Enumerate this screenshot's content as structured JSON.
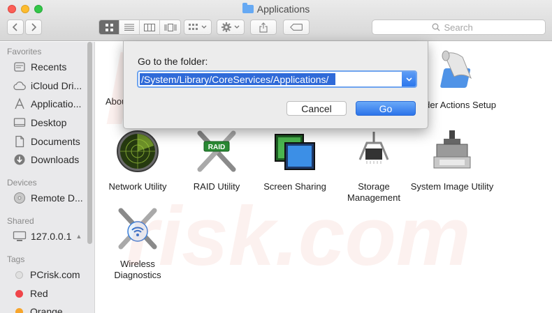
{
  "window": {
    "title": "Applications"
  },
  "toolbar": {
    "back_icon": "chevron-left-icon",
    "forward_icon": "chevron-right-icon",
    "view_modes": [
      "icon-view",
      "list-view",
      "column-view",
      "cover-flow-view"
    ],
    "search_placeholder": "Search"
  },
  "sidebar": {
    "sections": [
      {
        "title": "Favorites",
        "items": [
          {
            "label": "Recents",
            "icon": "clock-icon"
          },
          {
            "label": "iCloud Dri...",
            "icon": "cloud-icon"
          },
          {
            "label": "Applicatio...",
            "icon": "applications-icon"
          },
          {
            "label": "Desktop",
            "icon": "desktop-icon"
          },
          {
            "label": "Documents",
            "icon": "document-icon"
          },
          {
            "label": "Downloads",
            "icon": "download-icon"
          }
        ]
      },
      {
        "title": "Devices",
        "items": [
          {
            "label": "Remote D...",
            "icon": "disc-icon"
          }
        ]
      },
      {
        "title": "Shared",
        "items": [
          {
            "label": "127.0.0.1",
            "icon": "monitor-icon"
          }
        ]
      },
      {
        "title": "Tags",
        "items": [
          {
            "label": "PCrisk.com",
            "color": "#e0e0e0"
          },
          {
            "label": "Red",
            "color": "#f0454a"
          },
          {
            "label": "Orange",
            "color": "#f7a52c"
          }
        ]
      }
    ]
  },
  "apps": {
    "about": "Abou",
    "folder_actions": "older Actions Setup",
    "network_utility": "Network Utility",
    "raid_utility": "RAID Utility",
    "raid_badge": "RAID",
    "screen_sharing": "Screen Sharing",
    "storage_management": "Storage Management",
    "system_image_utility": "System Image Utility",
    "wireless_diagnostics": "Wireless Diagnostics"
  },
  "dialog": {
    "prompt": "Go to the folder:",
    "path_value": "/System/Library/CoreServices/Applications/",
    "cancel_label": "Cancel",
    "go_label": "Go"
  },
  "watermark": {
    "line1": "PC",
    "line2": "risk.com"
  },
  "colors": {
    "accent": "#2c74ea",
    "selection": "#2f6ad8"
  }
}
